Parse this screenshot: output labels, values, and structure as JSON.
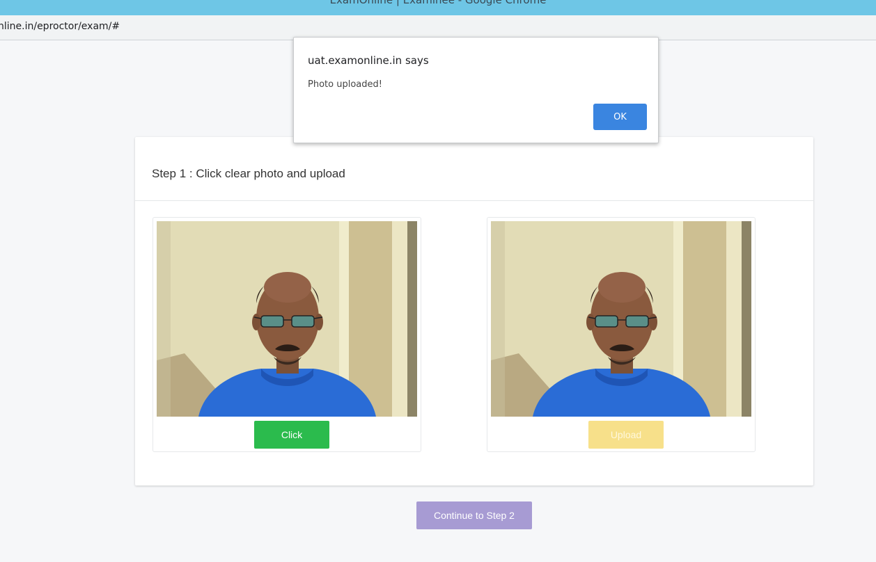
{
  "window": {
    "title": "ExamOnline | Examinee - Google Chrome"
  },
  "browser": {
    "url": "nline.in/eproctor/exam/#"
  },
  "dialog": {
    "origin": "uat.examonline.in says",
    "message": "Photo uploaded!",
    "ok_label": "OK"
  },
  "step": {
    "title": "Step 1 : Click clear photo and upload",
    "left_panel": {
      "button_label": "Click",
      "button_color": "#2bbb4d"
    },
    "right_panel": {
      "button_label": "Upload",
      "button_color": "#f7e08a"
    }
  },
  "footer": {
    "continue_label": "Continue to Step 2",
    "continue_color": "#a79bd3"
  }
}
